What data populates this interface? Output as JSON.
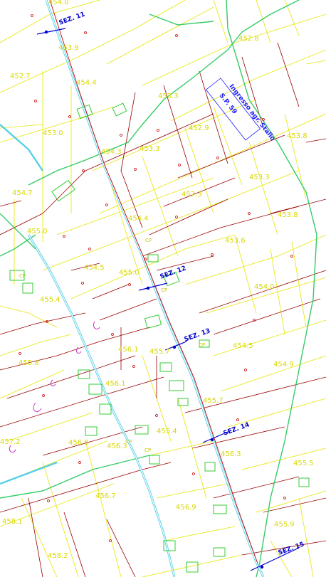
{
  "map": {
    "road_name_line1": "Ingresso agr. Stallo",
    "road_name_line2": "S.P. 59",
    "section_labels": [
      "SEZ. 11",
      "SEZ. 12",
      "SEZ. 13",
      "SEZ. 14",
      "SEZ. 15"
    ],
    "building_marker": "CP",
    "elevation_labels": [
      "454.0",
      "453.9",
      "452.8",
      "452.7",
      "454.4",
      "453.3",
      "452.9",
      "453.8",
      "454.3",
      "453.3",
      "453.0",
      "453.3",
      "452.3",
      "454.7",
      "454.4",
      "453.8",
      "455.0",
      "453.6",
      "454.5",
      "455.0",
      "454.0",
      "455.4",
      "454.5",
      "456.1",
      "455.7",
      "455.8",
      "454.9",
      "456.1",
      "455.7",
      "455.4",
      "456.3",
      "456.8",
      "456.3",
      "455.5",
      "456.7",
      "456.9",
      "455.9",
      "458.1",
      "458.2",
      "457.2"
    ]
  }
}
